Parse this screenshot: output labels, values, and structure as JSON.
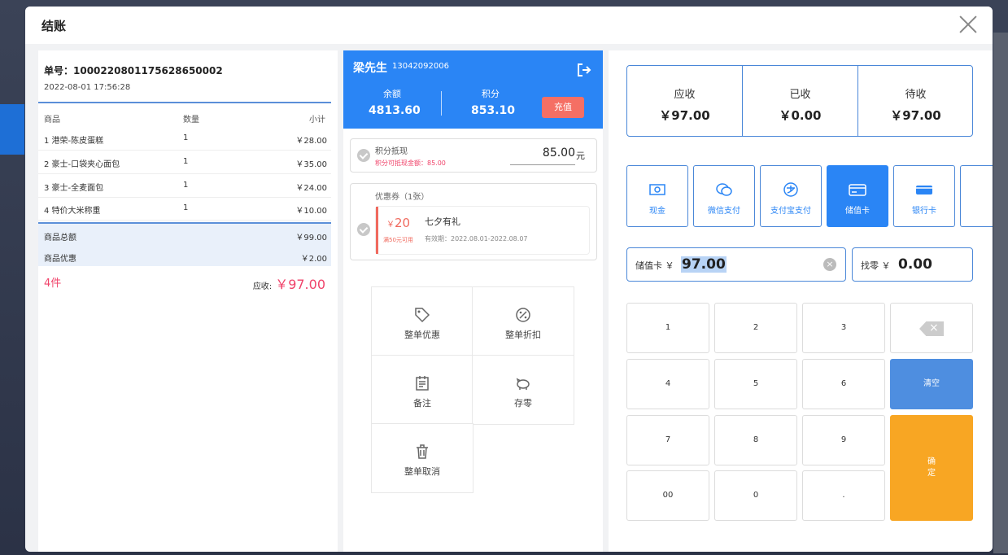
{
  "modal": {
    "title": "结账"
  },
  "order": {
    "number": "单号：1000220801175628650002",
    "time": "2022-08-01 17:56:28",
    "headers": {
      "name": "商品",
      "qty": "数量",
      "subtotal": "小计"
    },
    "items": [
      {
        "name": "1 港荣-陈皮蛋糕",
        "qty": "1",
        "subtotal": "￥28.00"
      },
      {
        "name": "2 豪士-口袋夹心面包",
        "qty": "1",
        "subtotal": "￥35.00"
      },
      {
        "name": "3 豪士-全麦面包",
        "qty": "1",
        "subtotal": "￥24.00"
      },
      {
        "name": "4 特价大米称重",
        "qty": "1",
        "subtotal": "￥10.00"
      }
    ],
    "total_label": "商品总额",
    "total_value": "￥99.00",
    "discount_label": "商品优惠",
    "discount_value": "￥2.00",
    "count": "4件",
    "due_label": "应收:",
    "due_value": "￥97.00"
  },
  "member": {
    "name": "梁先生",
    "phone": "13042092006",
    "balance_label": "余额",
    "balance_value": "4813.60",
    "points_label": "积分",
    "points_value": "853.10",
    "recharge_label": "充值"
  },
  "points_redeem": {
    "title": "积分抵现",
    "note": "积分可抵现金额：85.00",
    "value": "85.00",
    "unit": "元"
  },
  "coupon": {
    "title": "优惠券（1张）",
    "amount_prefix": "￥",
    "amount": "20",
    "condition": "满50元可用",
    "name": "七夕有礼",
    "validity": "有效期：2022.08.01-2022.08.07"
  },
  "actions": [
    {
      "label": "整单优惠",
      "icon": "tag-icon"
    },
    {
      "label": "整单折扣",
      "icon": "discount-icon"
    },
    {
      "label": "备注",
      "icon": "note-icon"
    },
    {
      "label": "存零",
      "icon": "piggy-bank-icon"
    },
    {
      "label": "整单取消",
      "icon": "trash-icon"
    }
  ],
  "totals": {
    "receivable_label": "应收",
    "receivable_value": "￥97.00",
    "received_label": "已收",
    "received_value": "￥0.00",
    "pending_label": "待收",
    "pending_value": "￥97.00"
  },
  "payment_methods": [
    {
      "label": "现金",
      "icon": "cash-icon"
    },
    {
      "label": "微信支付",
      "icon": "wechat-icon"
    },
    {
      "label": "支付宝支付",
      "icon": "alipay-icon"
    },
    {
      "label": "储值卡",
      "icon": "card-icon",
      "selected": true
    },
    {
      "label": "银行卡",
      "icon": "bank-card-icon"
    }
  ],
  "amount_input": {
    "label": "储值卡 ￥",
    "value": "97.00"
  },
  "change": {
    "label": "找零 ￥",
    "value": "0.00"
  },
  "keypad": {
    "k1": "1",
    "k2": "2",
    "k3": "3",
    "k4": "4",
    "k5": "5",
    "k6": "6",
    "k7": "7",
    "k8": "8",
    "k9": "9",
    "k00": "00",
    "k0": "0",
    "kdot": ".",
    "clear": "清空",
    "confirm_1": "确",
    "confirm_2": "定"
  },
  "colors": {
    "primary": "#2a85f5",
    "accent_red": "#f0436a",
    "confirm": "#f8a623",
    "clear": "#4e8ee0"
  }
}
